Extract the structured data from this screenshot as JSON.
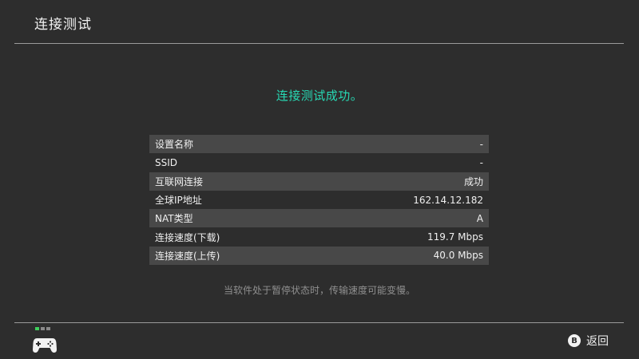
{
  "header": {
    "title": "连接测试"
  },
  "result": {
    "message": "连接测试成功。",
    "message_color": "#27d9b4"
  },
  "details": [
    {
      "label": "设置名称",
      "value": "-"
    },
    {
      "label": "SSID",
      "value": "-"
    },
    {
      "label": "互联网连接",
      "value": "成功"
    },
    {
      "label": "全球IP地址",
      "value": "162.14.12.182"
    },
    {
      "label": "NAT类型",
      "value": "A"
    },
    {
      "label": "连接速度(下载)",
      "value": "119.7 Mbps"
    },
    {
      "label": "连接速度(上传)",
      "value": "40.0 Mbps"
    }
  ],
  "note": "当软件处于暂停状态时，传输速度可能变慢。",
  "footer": {
    "controller_icon": "joy-con-controller-icon",
    "back_button_glyph": "B",
    "back_label": "返回"
  }
}
